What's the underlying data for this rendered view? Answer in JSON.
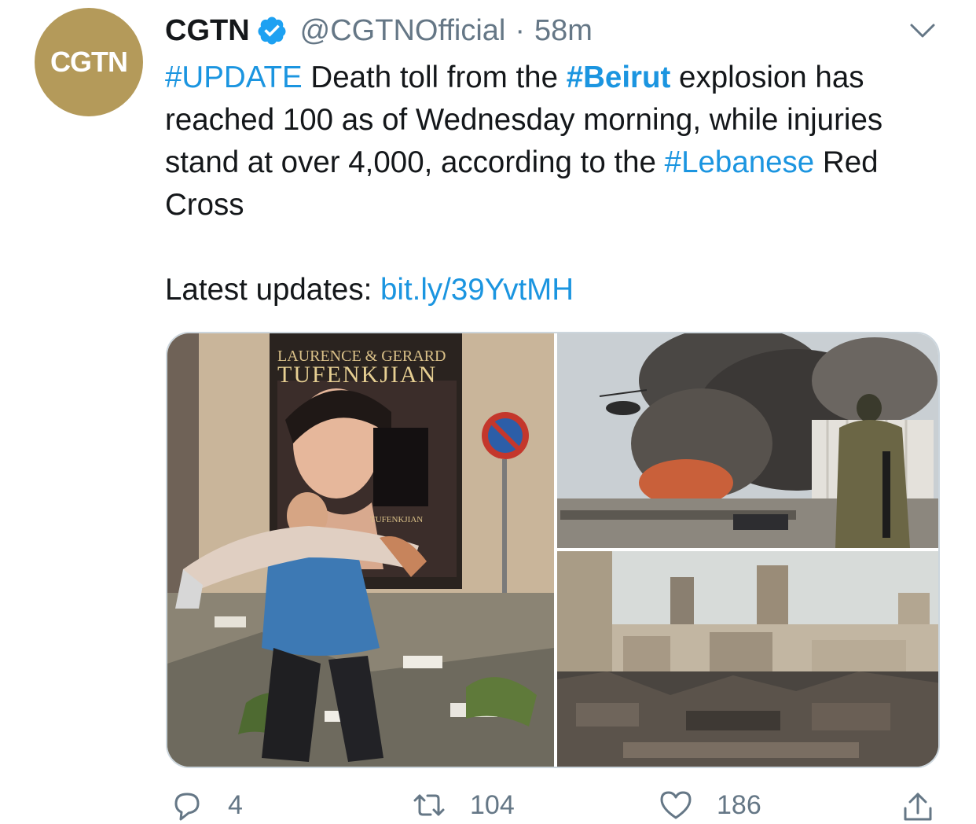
{
  "account": {
    "avatar_text": "CGTN",
    "name": "CGTN",
    "handle": "@CGTNOfficial",
    "separator": "·",
    "time": "58m"
  },
  "icons": {
    "verified": "verified-badge-icon",
    "menu": "chevron-down-icon",
    "reply": "reply-icon",
    "retweet": "retweet-icon",
    "like": "heart-icon",
    "share": "share-icon"
  },
  "tweet": {
    "seg1": "#UPDATE",
    "seg2": " Death toll from the ",
    "seg3": "#Beirut",
    "seg4": " explosion has reached 100 as of Wednesday morning, while injuries stand at over 4,000, according to the ",
    "seg5": "#Lebanese",
    "seg6": " Red Cross",
    "updates_label": "Latest updates: ",
    "updates_link": "bit.ly/39YvtMH"
  },
  "media": {
    "sign_line1": "LAURENCE & GERARD",
    "sign_line2": "TUFENKJIAN",
    "poster_small": "TUFENKJIAN"
  },
  "stats": {
    "replies": "4",
    "retweets": "104",
    "likes": "186"
  },
  "colors": {
    "link": "#1b95e0",
    "avatar_bg": "#b49a5a",
    "muted": "#657786"
  }
}
